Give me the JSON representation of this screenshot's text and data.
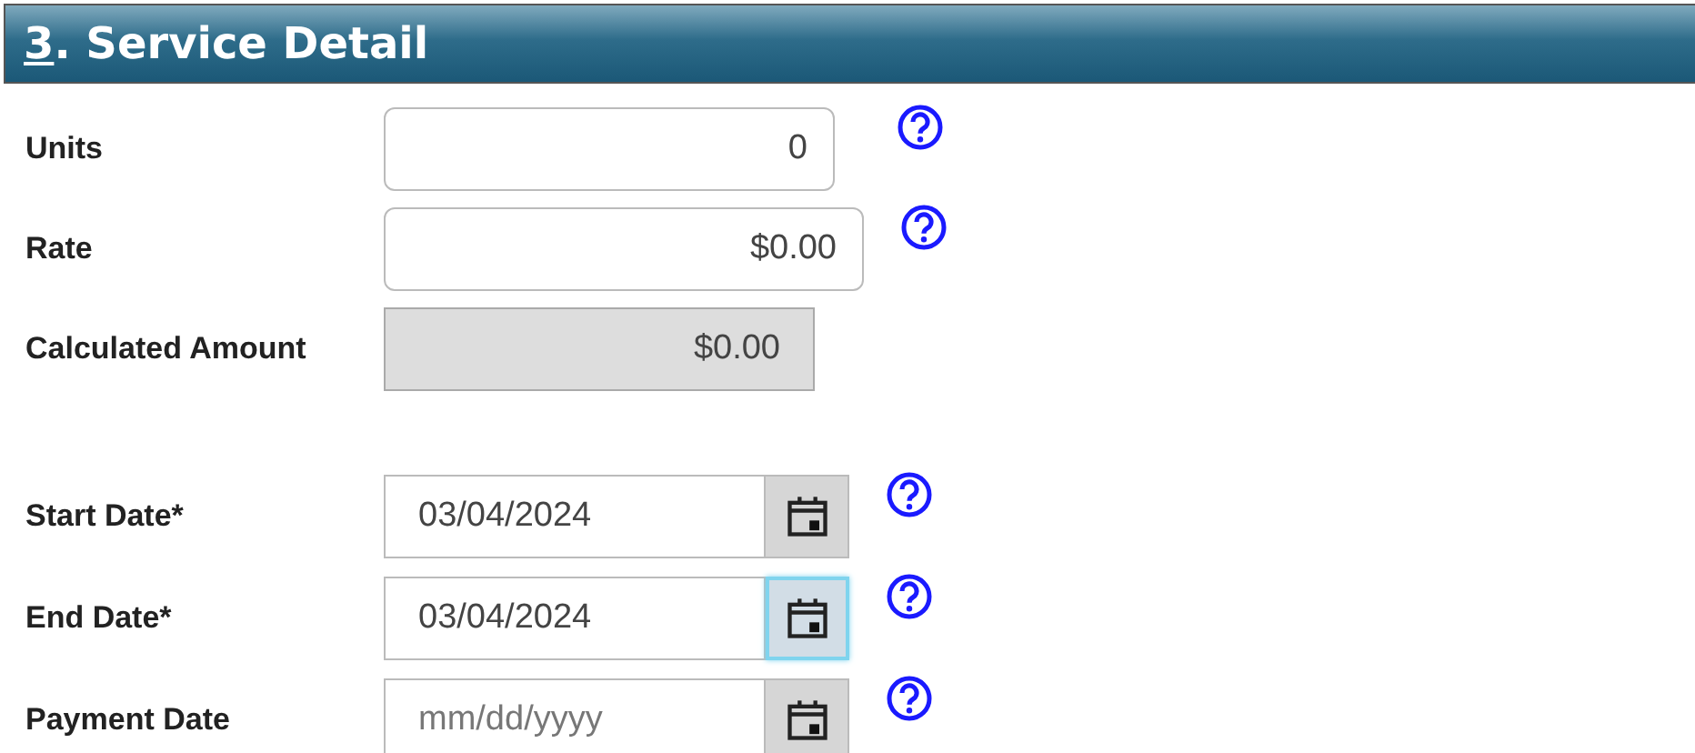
{
  "section": {
    "title": "3. Service Detail",
    "underline_first": true
  },
  "fields": [
    {
      "label": "Units",
      "kind": "count",
      "value": "0",
      "help": true
    },
    {
      "label": "Rate",
      "kind": "money",
      "value": "$0.00",
      "help": true
    },
    {
      "label": "Calculated Amount",
      "kind": "computed",
      "value": "$0.00",
      "help": false
    },
    {
      "label": "Start Date*",
      "kind": "date",
      "value": "03/04/2024",
      "help": true,
      "focused": false
    },
    {
      "label": "End Date*",
      "kind": "date",
      "value": "03/04/2024",
      "help": true,
      "focused": true
    },
    {
      "label": "Payment Date",
      "kind": "date",
      "placeholder": "mm/dd/yyyy",
      "help": true,
      "focused": false
    }
  ]
}
